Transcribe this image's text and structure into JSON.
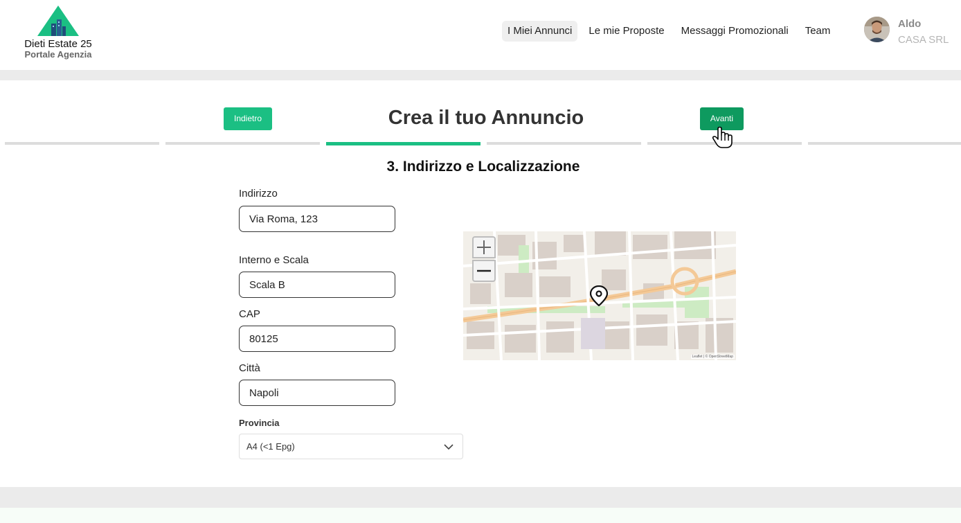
{
  "header": {
    "brand": "Dieti Estate 25",
    "subtitle": "Portale Agenzia",
    "nav": [
      {
        "label": "I Miei Annunci",
        "active": true
      },
      {
        "label": "Le mie Proposte",
        "active": false
      },
      {
        "label": "Messaggi Promozionali",
        "active": false
      },
      {
        "label": "Team",
        "active": false
      }
    ],
    "user": {
      "name": "Aldo",
      "company": "CASA SRL"
    }
  },
  "main": {
    "back_label": "Indietro",
    "next_label": "Avanti",
    "title": "Crea il tuo Annuncio",
    "steps_total": 6,
    "active_step": 3,
    "section_title": "3. Indirizzo e Localizzazione"
  },
  "form": {
    "address": {
      "label": "Indirizzo",
      "value": "Via Roma, 123"
    },
    "internal": {
      "label": "Interno e Scala",
      "value": "Scala B"
    },
    "cap": {
      "label": "CAP",
      "value": "80125"
    },
    "city": {
      "label": "Città",
      "value": "Napoli"
    },
    "province": {
      "label": "Provincia",
      "value": "A4  (<1 Epg)"
    }
  },
  "map": {
    "zoom_in": "+",
    "zoom_out": "−",
    "attribution": "Leaflet | © OpenStreetMap"
  },
  "colors": {
    "accent": "#1bbf83",
    "accent_dark": "#0e9a5f",
    "band": "#ebebeb"
  }
}
